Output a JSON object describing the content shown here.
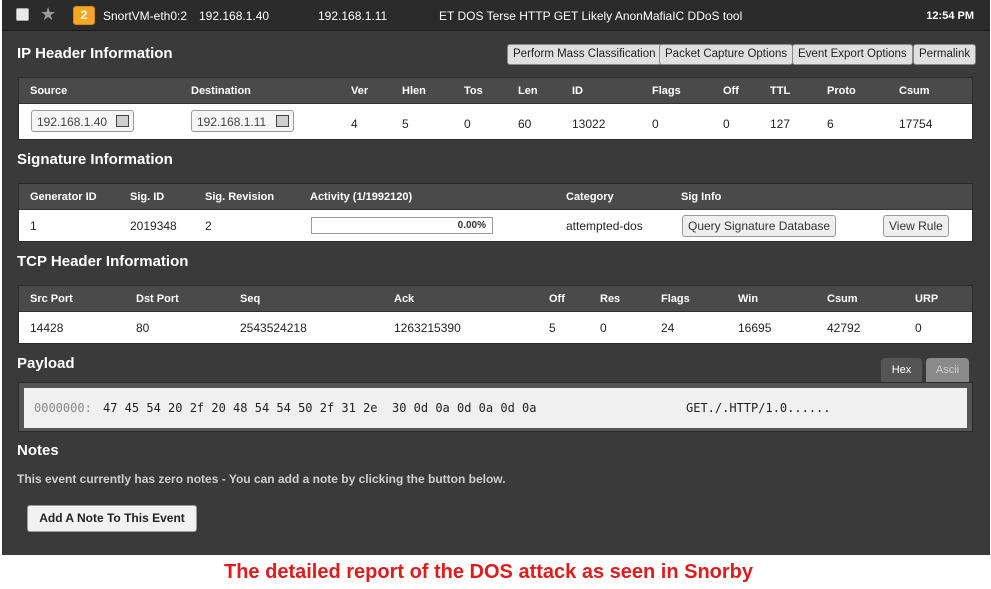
{
  "event": {
    "severity": "2",
    "sensor": "SnortVM-eth0:2",
    "source_ip": "192.168.1.40",
    "dest_ip": "192.168.1.11",
    "signature": "ET DOS Terse HTTP GET Likely AnonMafiaIC DDoS tool",
    "time": "12:54 PM"
  },
  "ip_header": {
    "title": "IP Header Information",
    "buttons": [
      "Perform Mass Classification",
      "Packet Capture Options",
      "Event Export Options",
      "Permalink"
    ],
    "columns": [
      "Source",
      "Destination",
      "Ver",
      "Hlen",
      "Tos",
      "Len",
      "ID",
      "Flags",
      "Off",
      "TTL",
      "Proto",
      "Csum"
    ],
    "row": [
      "192.168.1.40",
      "192.168.1.11",
      "4",
      "5",
      "0",
      "60",
      "13022",
      "0",
      "0",
      "127",
      "6",
      "17754"
    ]
  },
  "signature_info": {
    "title": "Signature Information",
    "columns": [
      "Generator ID",
      "Sig. ID",
      "Sig. Revision",
      "Activity (1/1992120)",
      "Category",
      "Sig Info"
    ],
    "row": [
      "1",
      "2019348",
      "2",
      "0.00%",
      "attempted-dos"
    ],
    "activity_fraction": 0.0,
    "query_button": "Query Signature Database",
    "view_rule_button": "View Rule"
  },
  "tcp_header": {
    "title": "TCP Header Information",
    "columns": [
      "Src Port",
      "Dst Port",
      "Seq",
      "Ack",
      "Off",
      "Res",
      "Flags",
      "Win",
      "Csum",
      "URP"
    ],
    "row": [
      "14428",
      "80",
      "2543524218",
      "1263215390",
      "5",
      "0",
      "24",
      "16695",
      "42792",
      "0"
    ]
  },
  "payload": {
    "title": "Payload",
    "tabs": [
      "Hex",
      "Ascii"
    ],
    "active_tab": "Hex",
    "offset": "0000000:",
    "hex": "47 45 54 20 2f 20 48 54 54 50 2f 31 2e  30 0d 0a 0d 0a 0d 0a",
    "ascii": "GET./.HTTP/1.0......"
  },
  "notes": {
    "title": "Notes",
    "text": "This event currently has zero notes - You can add a note by clicking the button below.",
    "button": "Add A Note To This Event"
  },
  "caption": "The detailed report of the DOS attack as seen in Snorby",
  "colors": {
    "severity_badge": "#f5a623",
    "panel_bg": "#3a3a3a",
    "caption": "#e01b1b"
  }
}
